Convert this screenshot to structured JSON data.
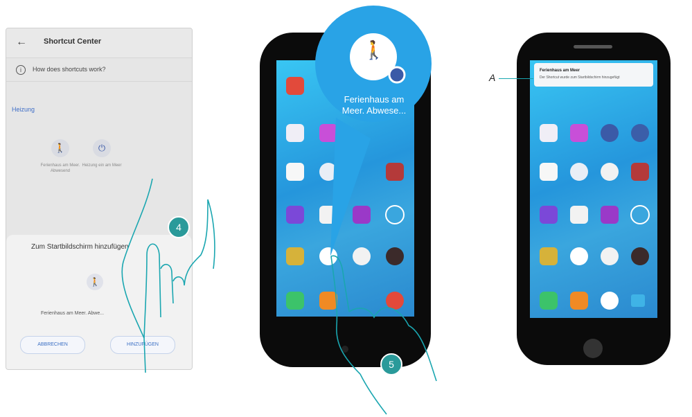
{
  "left_screen": {
    "back_icon": "arrow-left-icon",
    "title": "Shortcut Center",
    "info_text": "How does shortcuts work?",
    "section": "Heizung",
    "shortcuts": [
      {
        "label": "Ferienhaus am Meer. Abwesend",
        "icon": "walking-person-icon"
      },
      {
        "label": "Heizung ein am Meer",
        "icon": "power-icon"
      }
    ],
    "sheet": {
      "title": "Zum Startbildschirm hinzufügen",
      "shortcut_name": "Ferienhaus am Meer. Abwe...",
      "cancel_label": "ABBRECHEN",
      "add_label": "HINZUFÜGEN"
    }
  },
  "middle_phone": {
    "zoom_label": "Ferienhaus am Meer. Abwese..."
  },
  "right_phone": {
    "notification_title": "Ferienhaus am Meer",
    "notification_text": "Der Shortcut wurde zum Startbildschirm hinzugefügt"
  },
  "steps": {
    "step4": "4",
    "step5": "5"
  },
  "callout": {
    "label": "A"
  },
  "colors": {
    "accent_blue": "#3f6ec7",
    "badge": "#2a9a9a",
    "screen": "#2596dc",
    "phone_body": "#0b0b0b"
  }
}
